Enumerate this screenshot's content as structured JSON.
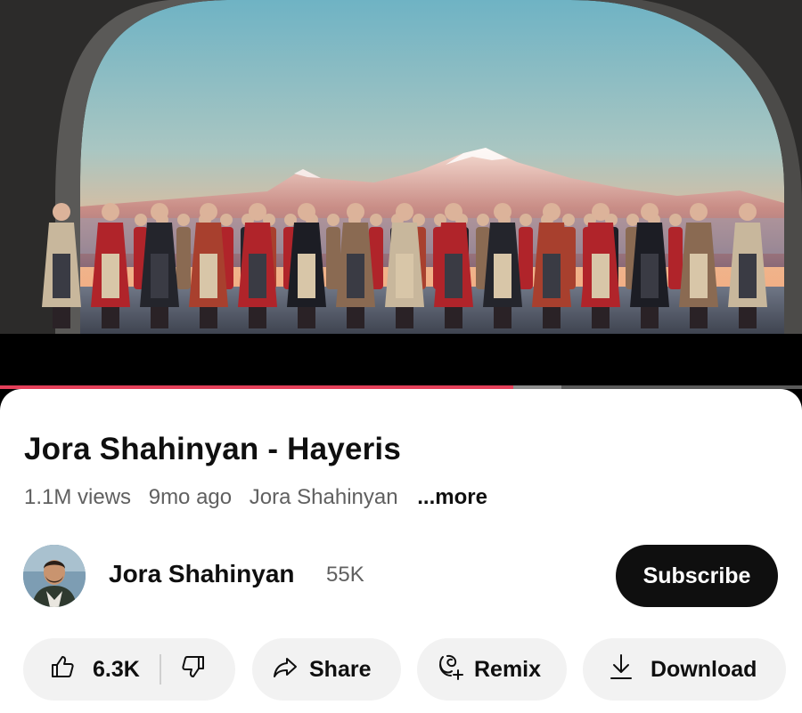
{
  "player": {
    "played_fraction": 0.64,
    "buffered_fraction": 0.7
  },
  "video": {
    "title": "Jora Shahinyan - Hayeris",
    "views": "1.1M views",
    "age": "9mo ago",
    "channel_inline": "Jora Shahinyan",
    "more_label": "...more"
  },
  "channel": {
    "name": "Jora Shahinyan",
    "subscribers": "55K",
    "subscribe_label": "Subscribe"
  },
  "actions": {
    "like_count": "6.3K",
    "share_label": "Share",
    "remix_label": "Remix",
    "download_label": "Download"
  },
  "colors": {
    "progress_played": "#e5405a",
    "subscribe_bg": "#0f0f0f",
    "pill_bg": "#f2f2f2"
  },
  "icons": {
    "like": "thumbs-up-icon",
    "dislike": "thumbs-down-icon",
    "share": "share-arrow-icon",
    "remix": "remix-icon",
    "download": "download-arrow-icon"
  }
}
